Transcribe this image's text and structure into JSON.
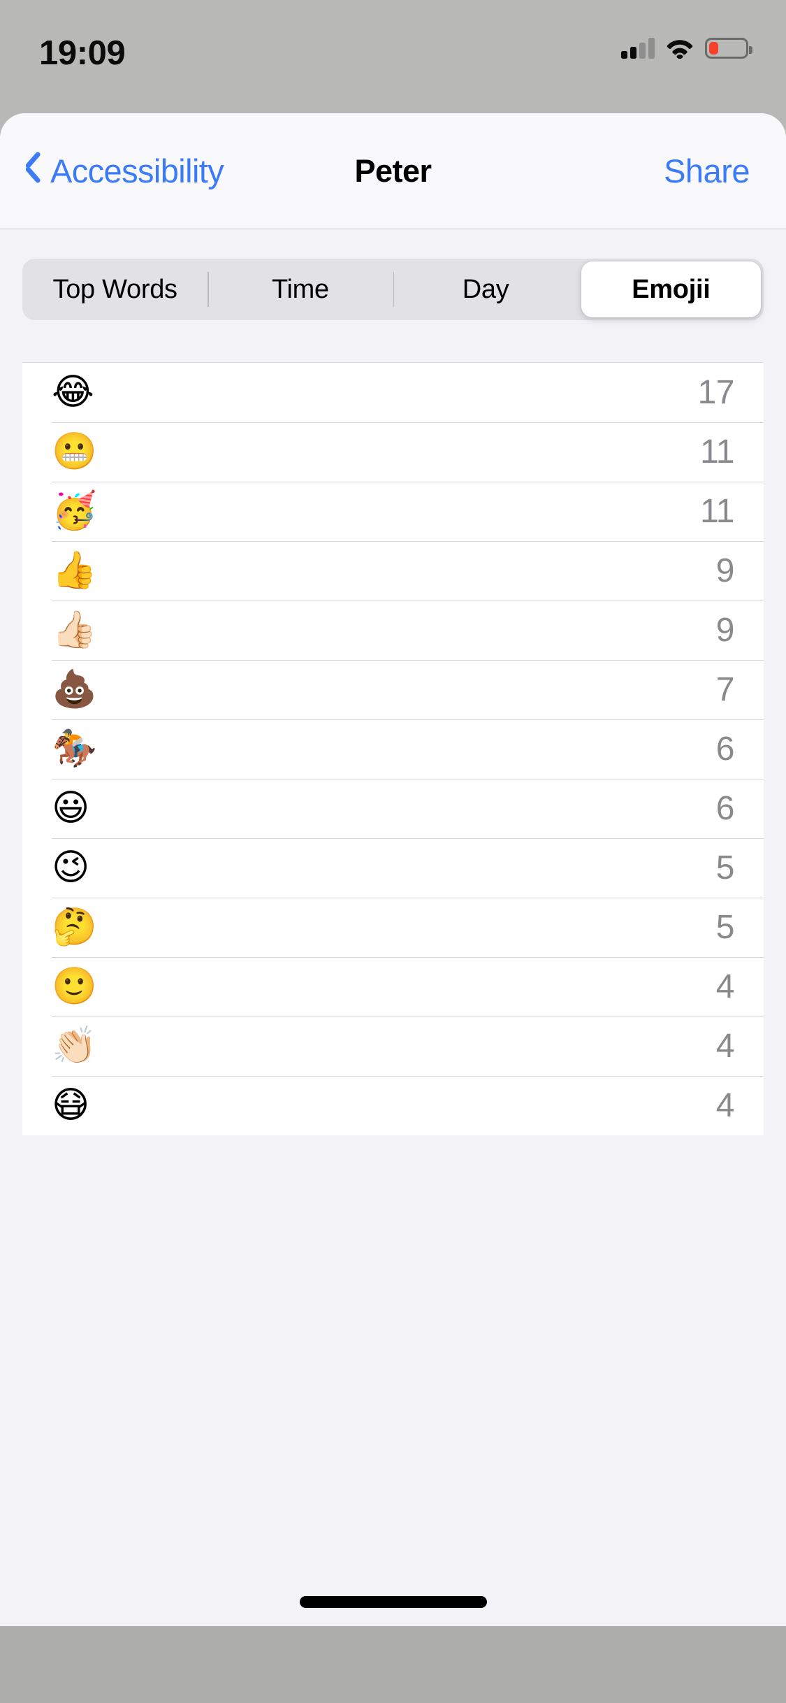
{
  "status_bar": {
    "time": "19:09",
    "cellular_icon": "cellular-signal-icon",
    "cellular_bars_filled": 2,
    "cellular_bars_total": 4,
    "wifi_icon": "wifi-icon",
    "battery_icon": "battery-icon",
    "battery_level_percent": 25,
    "battery_color": "#f8402c"
  },
  "nav": {
    "back_label": "Accessibility",
    "back_icon": "chevron-left-icon",
    "title": "Peter",
    "share_label": "Share",
    "tint_color": "#3b7cf6"
  },
  "segmented": {
    "options": [
      "Top Words",
      "Time",
      "Day",
      "Emojii"
    ],
    "selected": "Emojii",
    "selected_index": 3
  },
  "list": {
    "rows": [
      {
        "emoji": "😂",
        "emoji_name": "face-with-tears-of-joy",
        "count": "17"
      },
      {
        "emoji": "😬",
        "emoji_name": "grimacing-face",
        "count": "11"
      },
      {
        "emoji": "🥳",
        "emoji_name": "partying-face",
        "count": "11"
      },
      {
        "emoji": "👍",
        "emoji_name": "thumbs-up",
        "count": "9"
      },
      {
        "emoji": "👍🏻",
        "emoji_name": "thumbs-up-light-skin-tone",
        "count": "9"
      },
      {
        "emoji": "💩",
        "emoji_name": "pile-of-poo",
        "count": "7"
      },
      {
        "emoji": "🏇",
        "emoji_name": "horse-racing",
        "count": "6"
      },
      {
        "emoji": "😃",
        "emoji_name": "grinning-face-with-big-eyes",
        "count": "6"
      },
      {
        "emoji": "😉",
        "emoji_name": "winking-face",
        "count": "5"
      },
      {
        "emoji": "🤔",
        "emoji_name": "thinking-face",
        "count": "5"
      },
      {
        "emoji": "🙂",
        "emoji_name": "slightly-smiling-face",
        "count": "4"
      },
      {
        "emoji": "👏🏻",
        "emoji_name": "clapping-hands-light-skin-tone",
        "count": "4"
      },
      {
        "emoji": "😷",
        "emoji_name": "face-with-medical-mask",
        "count": "4"
      }
    ]
  },
  "home_indicator": {
    "name": "home-indicator"
  }
}
